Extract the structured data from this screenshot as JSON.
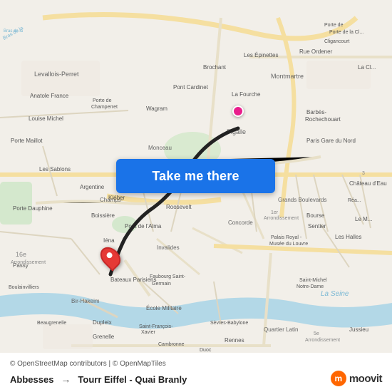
{
  "map": {
    "attribution": "© OpenStreetMap contributors | © OpenMapTiles",
    "background_color": "#f2efe9",
    "water_color": "#a8d4e6",
    "park_color": "#c8e6c0"
  },
  "button": {
    "label": "Take me there",
    "bg_color": "#1a73e8",
    "text_color": "#ffffff"
  },
  "route": {
    "origin": "Abbesses",
    "destination": "Tourr Eiffel - Quai Branly",
    "arrow": "→"
  },
  "attribution": {
    "text": "© OpenStreetMap contributors | © OpenMapTiles"
  },
  "moovit": {
    "logo_letter": "m",
    "brand_name": "moovit",
    "brand_color": "#ff6600"
  },
  "labels": {
    "levallois": "Levallois-Perret",
    "montmartre": "Montmartre",
    "pigalle": "Pigalle",
    "monceau": "Monceau",
    "bir_hakeim": "Bir-Hakeim",
    "invalides": "Invalides",
    "champs": "Champs-",
    "concorde": "Concorde",
    "grands_boulvards": "Grands Boulevards",
    "latin": "Quartier Latin",
    "seine": "La Seine"
  }
}
